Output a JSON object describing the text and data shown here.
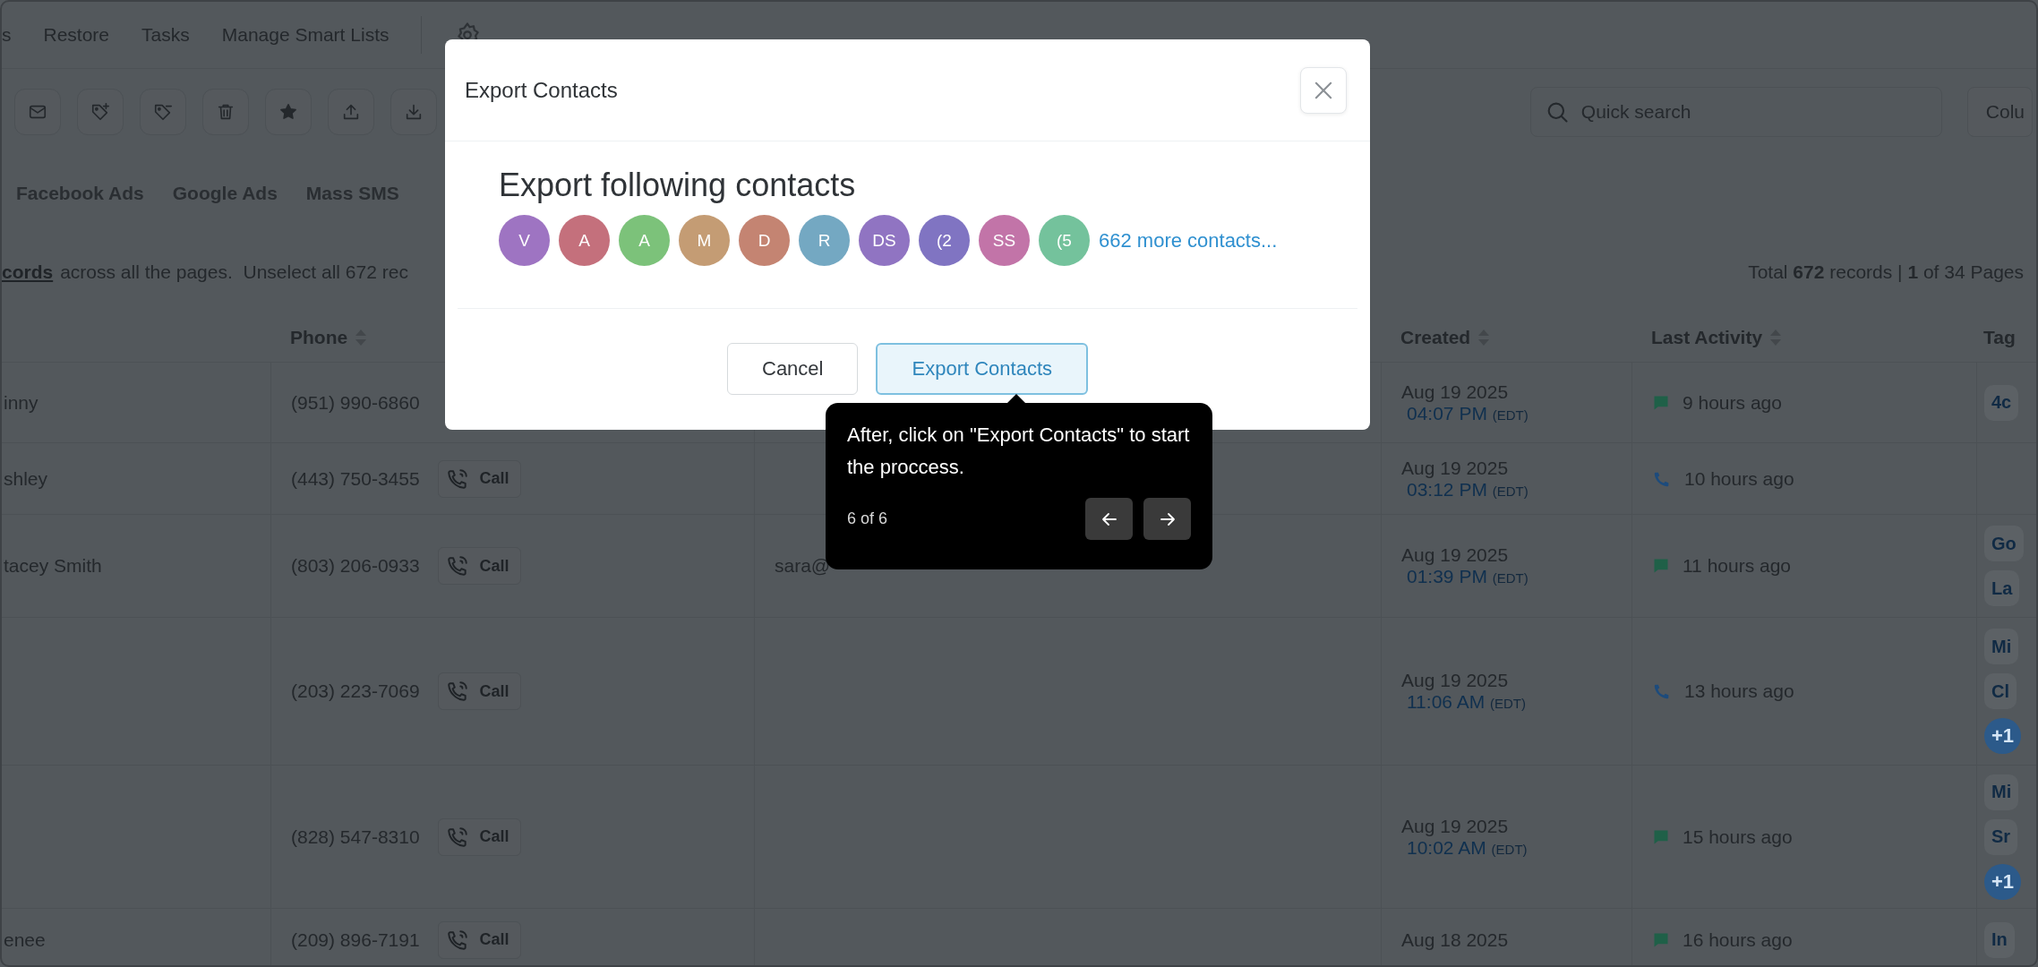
{
  "nav": {
    "items": [
      "s",
      "Restore",
      "Tasks",
      "Manage Smart Lists"
    ]
  },
  "toolbar": {
    "search": {
      "placeholder": "Quick search"
    },
    "columns_button": "Colu"
  },
  "tabs": [
    "Facebook Ads",
    "Google Ads",
    "Mass SMS"
  ],
  "selection_notice": {
    "link": "cords",
    "text": "across all the pages.  Unselect all 672 rec"
  },
  "pagination": "Total **672** records | **1** of 34 Pages",
  "table": {
    "columns": {
      "phone": "Phone",
      "created": "Created",
      "last_activity": "Last Activity",
      "tags": "Tag"
    },
    "rows": [
      {
        "name": "inny",
        "phone": "(951) 990-6860",
        "created_date": "Aug 19 2025",
        "created_time": "04:07 PM",
        "timezone": "(EDT)",
        "activity": {
          "kind": "message",
          "text": "9 hours ago"
        },
        "tags": [
          {
            "label": "4c",
            "kind": "tag"
          }
        ]
      },
      {
        "name": "shley",
        "phone": "(443) 750-3455",
        "call": "Call",
        "created_date": "Aug 19 2025",
        "created_time": "03:12 PM",
        "timezone": "(EDT)",
        "activity": {
          "kind": "call",
          "text": "10 hours ago"
        },
        "tags": []
      },
      {
        "name": "tacey Smith",
        "phone": "(803) 206-0933",
        "call": "Call",
        "email": "sara@",
        "created_date": "Aug 19 2025",
        "created_time": "01:39 PM",
        "timezone": "(EDT)",
        "activity": {
          "kind": "message",
          "text": "11 hours ago"
        },
        "tags": [
          {
            "label": "Go",
            "kind": "tag"
          },
          {
            "label": "La",
            "kind": "tag"
          }
        ]
      },
      {
        "phone": "(203) 223-7069",
        "call": "Call",
        "created_date": "Aug 19 2025",
        "created_time": "11:06 AM",
        "timezone": "(EDT)",
        "activity": {
          "kind": "call",
          "text": "13 hours ago"
        },
        "tags": [
          {
            "label": "Mi",
            "kind": "tag"
          },
          {
            "label": "Cl",
            "kind": "tag"
          },
          {
            "label": "+1",
            "kind": "more"
          }
        ]
      },
      {
        "phone": "(828) 547-8310",
        "call": "Call",
        "created_date": "Aug 19 2025",
        "created_time": "10:02 AM",
        "timezone": "(EDT)",
        "activity": {
          "kind": "message",
          "text": "15 hours ago"
        },
        "tags": [
          {
            "label": "Mi",
            "kind": "tag"
          },
          {
            "label": "Sr",
            "kind": "tag"
          },
          {
            "label": "+1",
            "kind": "more"
          }
        ]
      },
      {
        "name": "enee",
        "phone": "(209) 896-7191",
        "call": "Call",
        "created_date": "Aug 18 2025",
        "activity": {
          "kind": "message",
          "text": "16 hours ago"
        },
        "tags": [
          {
            "label": "In",
            "kind": "tag"
          }
        ]
      }
    ]
  },
  "modal": {
    "title": "Export Contacts",
    "heading": "Export following contacts",
    "avatars": [
      {
        "initials": "V",
        "color": "#9e74c2"
      },
      {
        "initials": "A",
        "color": "#c4707c"
      },
      {
        "initials": "A",
        "color": "#7cc27a"
      },
      {
        "initials": "M",
        "color": "#c49c74"
      },
      {
        "initials": "D",
        "color": "#c48472"
      },
      {
        "initials": "R",
        "color": "#74a8c2"
      },
      {
        "initials": "DS",
        "color": "#9074c2"
      },
      {
        "initials": "(2",
        "color": "#8074c2"
      },
      {
        "initials": "SS",
        "color": "#c274a8"
      },
      {
        "initials": "(5",
        "color": "#74c29c"
      }
    ],
    "more_link": "662 more contacts...",
    "cancel_button": "Cancel",
    "export_button": "Export Contacts"
  },
  "tour": {
    "text": "After, click on \"Export Contacts\" to start the proccess.",
    "step": "6 of 6"
  }
}
